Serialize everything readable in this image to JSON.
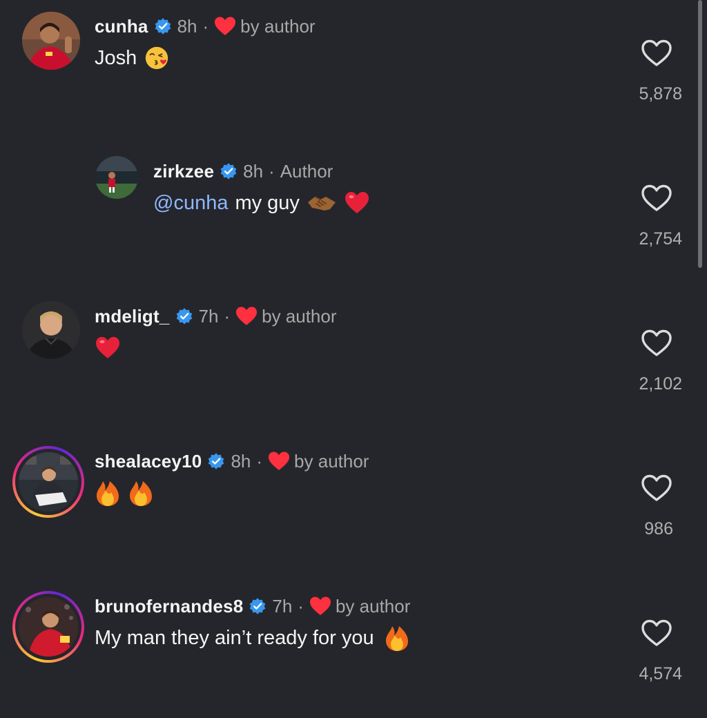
{
  "comments": [
    {
      "username": "cunha",
      "time": "8h",
      "separator": "·",
      "liked_by_author_label": "by author",
      "text": "Josh",
      "emoji": "kissing-face-emoji",
      "likes": "5,878"
    },
    {
      "username": "zirkzee",
      "time": "8h",
      "separator": "·",
      "author_label": "Author",
      "mention": "@cunha",
      "text": "my guy",
      "emoji": [
        "handshake-emoji",
        "red-heart-emoji"
      ],
      "likes": "2,754"
    },
    {
      "username": "mdeligt_",
      "time": "7h",
      "separator": "·",
      "liked_by_author_label": "by author",
      "emoji": "red-heart-emoji",
      "likes": "2,102"
    },
    {
      "username": "shealacey10",
      "time": "8h",
      "separator": "·",
      "liked_by_author_label": "by author",
      "emoji": [
        "fire-emoji",
        "fire-emoji"
      ],
      "likes": "986"
    },
    {
      "username": "brunofernandes8",
      "time": "7h",
      "separator": "·",
      "liked_by_author_label": "by author",
      "text": "My man they ain’t ready for you",
      "emoji": "fire-emoji",
      "likes": "4,574"
    }
  ],
  "colors": {
    "background": "#25262b",
    "verified_badge": "#3897f0",
    "heart_red": "#ff3040",
    "mention_blue": "#8fb8ff",
    "secondary_text": "#a8a8a8"
  },
  "icons": {
    "verified": "verified-badge-icon",
    "author_like": "red-heart-icon",
    "like_button": "heart-outline-icon"
  }
}
